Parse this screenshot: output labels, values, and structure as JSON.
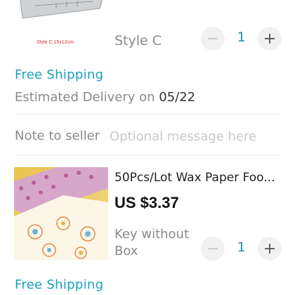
{
  "items": [
    {
      "image_caption": "Style C:15x12cm",
      "option": "Style C",
      "quantity": "1",
      "shipping": "Free Shipping",
      "delivery_prefix": "Estimated Delivery on",
      "delivery_date": "05/22"
    },
    {
      "title": "50Pcs/Lot Wax Paper Foo...",
      "price": "US $3.37",
      "option": "Key without Box",
      "quantity": "1",
      "shipping": "Free Shipping"
    }
  ],
  "note": {
    "label": "Note to seller",
    "placeholder": "Optional message here"
  },
  "stepper": {
    "minus": "−",
    "plus": "+"
  },
  "colors": {
    "accent": "#1aa1bf",
    "qty": "#1f8ea6",
    "muted": "#8a8a8a"
  },
  "icons": {
    "minus": "minus-icon",
    "plus": "plus-icon"
  }
}
